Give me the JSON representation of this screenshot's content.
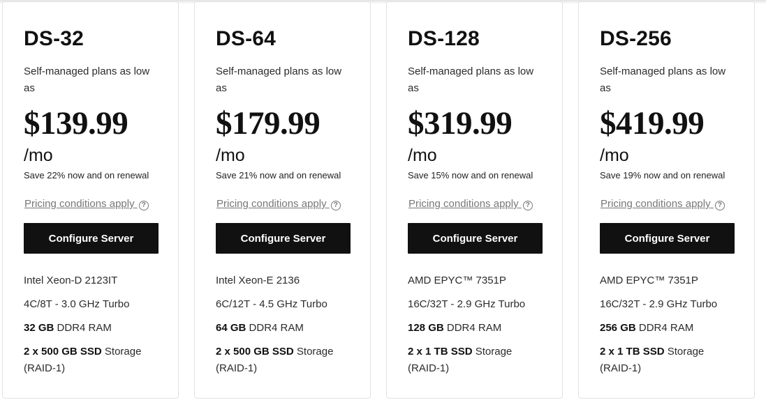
{
  "common": {
    "tagline": "Self-managed plans as low as",
    "period": "/mo",
    "conditions_label": "Pricing conditions apply",
    "help_glyph": "?",
    "button_label": "Configure Server",
    "storage_suffix": "Storage",
    "raid": "(RAID-1)",
    "ram_suffix": "DDR4 RAM"
  },
  "plans": [
    {
      "name": "DS-32",
      "price": "$139.99",
      "savings": "Save 22% now and on renewal",
      "cpu": "Intel Xeon-D 2123IT",
      "cores": "4C/8T - 3.0 GHz Turbo",
      "ram": "32 GB",
      "storage": "2 x 500 GB SSD"
    },
    {
      "name": "DS-64",
      "price": "$179.99",
      "savings": "Save 21% now and on renewal",
      "cpu": "Intel Xeon-E 2136",
      "cores": "6C/12T - 4.5 GHz Turbo",
      "ram": "64 GB",
      "storage": "2 x 500 GB SSD"
    },
    {
      "name": "DS-128",
      "price": "$319.99",
      "savings": "Save 15% now and on renewal",
      "cpu": "AMD EPYC™ 7351P",
      "cores": "16C/32T - 2.9 GHz Turbo",
      "ram": "128 GB",
      "storage": "2 x 1 TB SSD"
    },
    {
      "name": "DS-256",
      "price": "$419.99",
      "savings": "Save 19% now and on renewal",
      "cpu": "AMD EPYC™ 7351P",
      "cores": "16C/32T - 2.9 GHz Turbo",
      "ram": "256 GB",
      "storage": "2 x 1 TB SSD"
    }
  ]
}
